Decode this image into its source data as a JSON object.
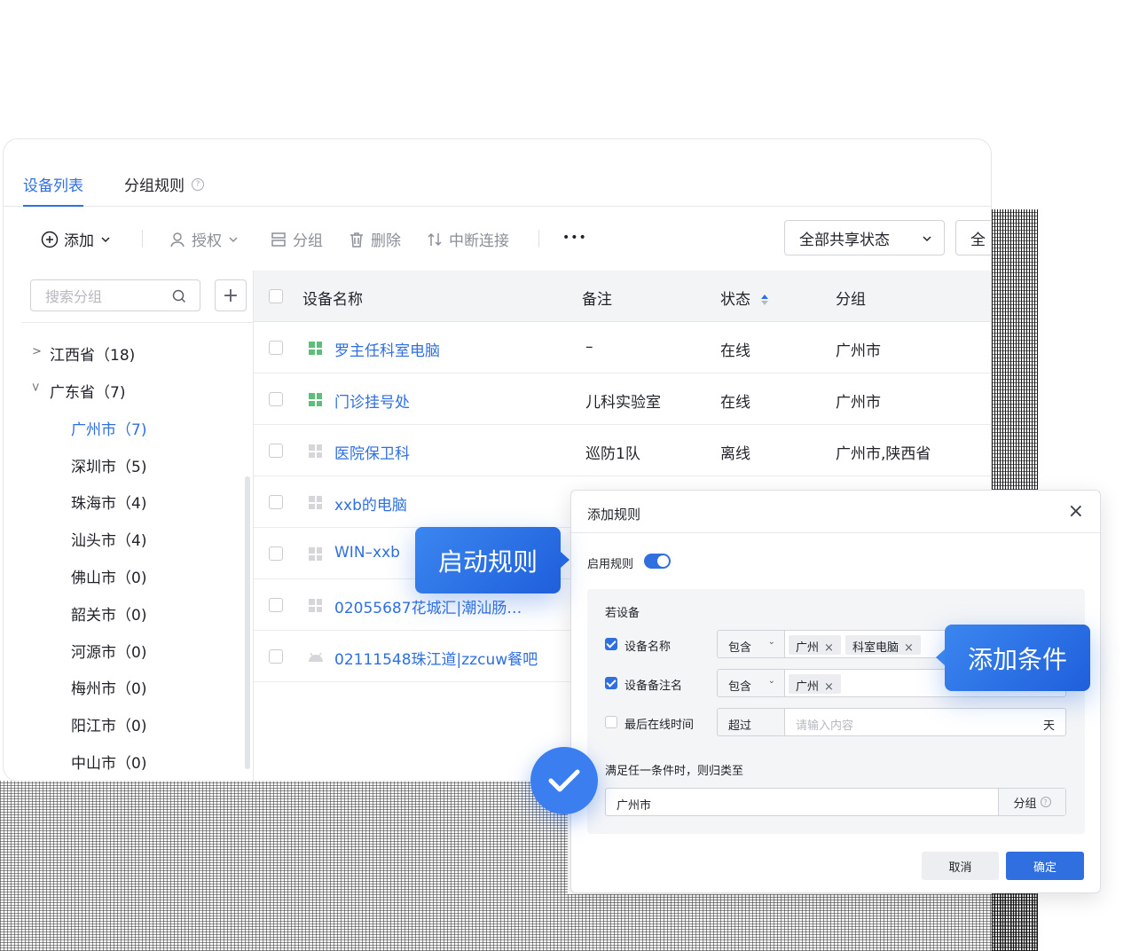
{
  "tabs": {
    "device_list": "设备列表",
    "group_rules": "分组规则",
    "help_mark": "?"
  },
  "toolbar": {
    "add": "添加",
    "authorize": "授权",
    "group": "分组",
    "delete": "删除",
    "disconnect": "中断连接",
    "more": "•••",
    "share_filter": "全部共享状态",
    "second_filter": "全"
  },
  "sidebar": {
    "search_placeholder": "搜索分组",
    "add_symbol": "+",
    "items": [
      {
        "label": "江西省（18)",
        "level": 0,
        "expanded": false
      },
      {
        "label": "广东省（7)",
        "level": 0,
        "expanded": true
      },
      {
        "label": "广州市（7)",
        "level": 1,
        "active": true
      },
      {
        "label": "深圳市（5)",
        "level": 1
      },
      {
        "label": "珠海市（4)",
        "level": 1
      },
      {
        "label": "汕头市（4)",
        "level": 1
      },
      {
        "label": "佛山市（0)",
        "level": 1
      },
      {
        "label": "韶关市（0)",
        "level": 1
      },
      {
        "label": "河源市（0)",
        "level": 1
      },
      {
        "label": "梅州市（0)",
        "level": 1
      },
      {
        "label": "阳江市（0)",
        "level": 1
      },
      {
        "label": "中山市（0)",
        "level": 1
      }
    ]
  },
  "table": {
    "headers": {
      "name": "设备名称",
      "note": "备注",
      "status": "状态",
      "group": "分组"
    },
    "rows": [
      {
        "name": "罗主任科室电脑",
        "note": "–",
        "status": "在线",
        "group": "广州市",
        "online": true
      },
      {
        "name": "门诊挂号处",
        "note": "儿科实验室",
        "status": "在线",
        "group": "广州市",
        "online": true
      },
      {
        "name": "医院保卫科",
        "note": "巡防1队",
        "status": "离线",
        "group": "广州市,陕西省",
        "online": false
      },
      {
        "name": "xxb的电脑",
        "note": "",
        "status": "",
        "group": "",
        "online": false
      },
      {
        "name": "WIN–xxb",
        "note": "",
        "status": "",
        "group": "",
        "online": false
      },
      {
        "name": "02055687花城汇|潮汕肠…",
        "note": "",
        "status": "",
        "group": "",
        "online": false
      },
      {
        "name": "02111548珠江道|zzcuw餐吧",
        "note": "",
        "status": "",
        "group": "",
        "online": false
      }
    ]
  },
  "dialog": {
    "title": "添加规则",
    "close": "×",
    "enable_label": "启用规则",
    "if_title": "若设备",
    "conditions": [
      {
        "label": "设备名称",
        "checked": true,
        "op": "包含",
        "tags": [
          "广州",
          "科室电脑"
        ]
      },
      {
        "label": "设备备注名",
        "checked": true,
        "op": "包含",
        "tags": [
          "广州"
        ]
      },
      {
        "label": "最后在线时间",
        "checked": false,
        "op": "超过",
        "placeholder": "请输入内容",
        "unit": "天"
      }
    ],
    "then_title": "满足任一条件时，则归类至",
    "group_value": "广州市",
    "group_suffix": "分组",
    "cancel": "取消",
    "ok": "确定"
  },
  "callouts": {
    "start": "启动规则",
    "add": "添加条件"
  },
  "colors": {
    "accent": "#2f6fe0",
    "online_icon": "#5bbf7a",
    "offline_icon": "#c9ccd2"
  }
}
